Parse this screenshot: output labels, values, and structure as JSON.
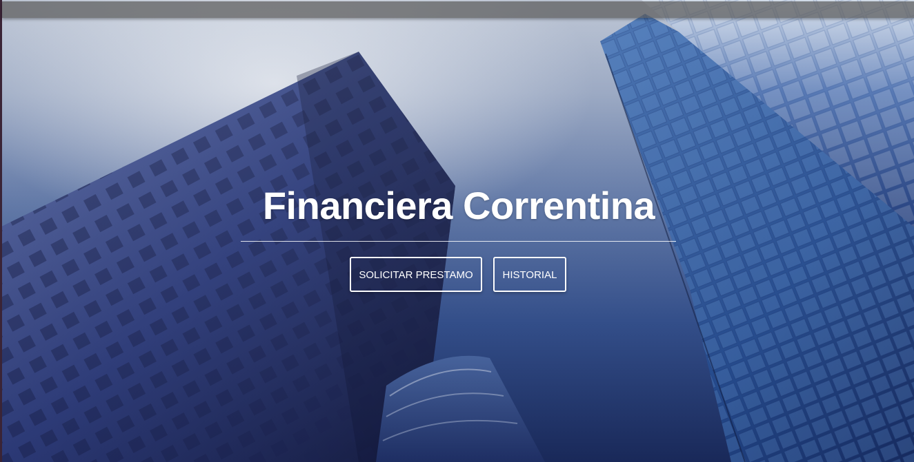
{
  "hero": {
    "title": "Financiera Correntina",
    "buttons": {
      "request_loan": "SOLICITAR PRESTAMO",
      "history": "HISTORIAL"
    }
  },
  "colors": {
    "text": "#ffffff",
    "navbar": "#5a5a5a",
    "sky_top": "#b9c2d2",
    "sky_bottom": "#1a2c5e"
  }
}
